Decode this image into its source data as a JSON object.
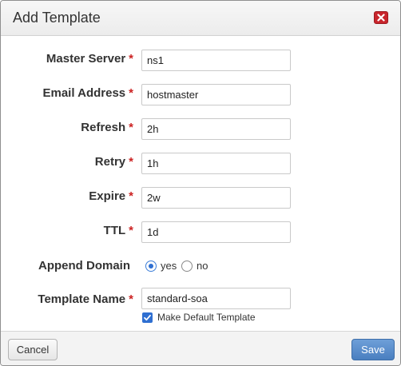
{
  "dialog": {
    "title": "Add Template",
    "close_icon": "close-icon"
  },
  "form": {
    "master_server": {
      "label": "Master Server",
      "required": "*",
      "value": "ns1"
    },
    "email_address": {
      "label": "Email Address",
      "required": "*",
      "value": "hostmaster"
    },
    "refresh": {
      "label": "Refresh",
      "required": "*",
      "value": "2h"
    },
    "retry": {
      "label": "Retry",
      "required": "*",
      "value": "1h"
    },
    "expire": {
      "label": "Expire",
      "required": "*",
      "value": "2w"
    },
    "ttl": {
      "label": "TTL",
      "required": "*",
      "value": "1d"
    },
    "append_domain": {
      "label": "Append Domain",
      "options": [
        {
          "label": "yes",
          "selected": true
        },
        {
          "label": "no",
          "selected": false
        }
      ]
    },
    "template_name": {
      "label": "Template Name",
      "required": "*",
      "value": "standard-soa"
    },
    "make_default": {
      "label": "Make Default Template",
      "checked": true
    }
  },
  "footer": {
    "cancel_label": "Cancel",
    "save_label": "Save"
  },
  "colors": {
    "required": "#cc2222",
    "accent": "#2f6fd1",
    "close": "#c8252c",
    "save_button": "#4a7fc0"
  }
}
